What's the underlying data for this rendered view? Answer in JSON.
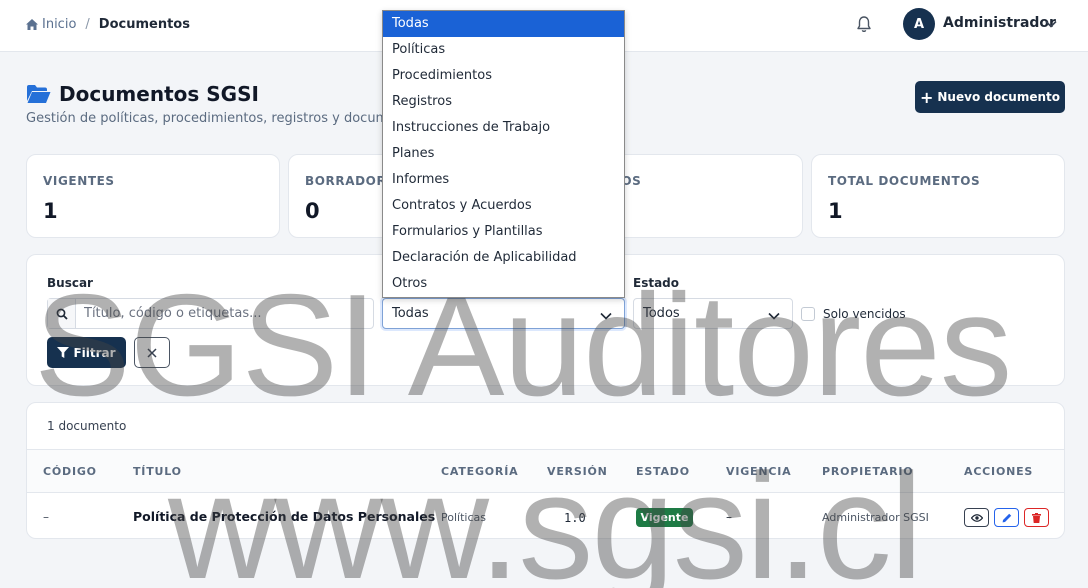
{
  "breadcrumb": {
    "home": "Inicio",
    "separator": "/",
    "current": "Documentos"
  },
  "user": {
    "initial": "A",
    "name": "Administrador"
  },
  "header": {
    "title": "Documentos SGSI",
    "subtitle": "Gestión de políticas, procedimientos, registros y documentos",
    "new_button": "Nuevo documento"
  },
  "stats": [
    {
      "label": "VIGENTES",
      "value": "1"
    },
    {
      "label": "BORRADORES",
      "value": "0"
    },
    {
      "label": "VENCIDOS",
      "value": ""
    },
    {
      "label": "TOTAL DOCUMENTOS",
      "value": "1"
    }
  ],
  "filters": {
    "search_label": "Buscar",
    "search_placeholder": "Título, código o etiquetas...",
    "category_selected": "Todas",
    "state_label": "Estado",
    "state_selected": "Todos",
    "only_expired_label": "Solo vencidos",
    "filter_button": "Filtrar",
    "clear_icon": "close-icon"
  },
  "category_options": [
    "Todas",
    "Políticas",
    "Procedimientos",
    "Registros",
    "Instrucciones de Trabajo",
    "Planes",
    "Informes",
    "Contratos y Acuerdos",
    "Formularios y Plantillas",
    "Declaración de Aplicabilidad",
    "Otros"
  ],
  "table": {
    "count": "1 documento",
    "headers": [
      "CÓDIGO",
      "TÍTULO",
      "CATEGORÍA",
      "VERSIÓN",
      "ESTADO",
      "VIGENCIA",
      "PROPIETARIO",
      "ACCIONES"
    ],
    "rows": [
      {
        "code": "–",
        "title": "Política de Protección de Datos Personales",
        "category": "Políticas",
        "version": "1.0",
        "status": "Vigente",
        "validity": "–",
        "owner": "Administrador SGSI"
      }
    ]
  },
  "watermark": {
    "line1": "SGSI Auditores",
    "line2": "www.sgsi.cl"
  },
  "colors": {
    "primary": "#16314f",
    "success": "#1e7b45",
    "danger": "#dc2626",
    "info": "#2563eb",
    "selected_option": "#1a62d6"
  }
}
